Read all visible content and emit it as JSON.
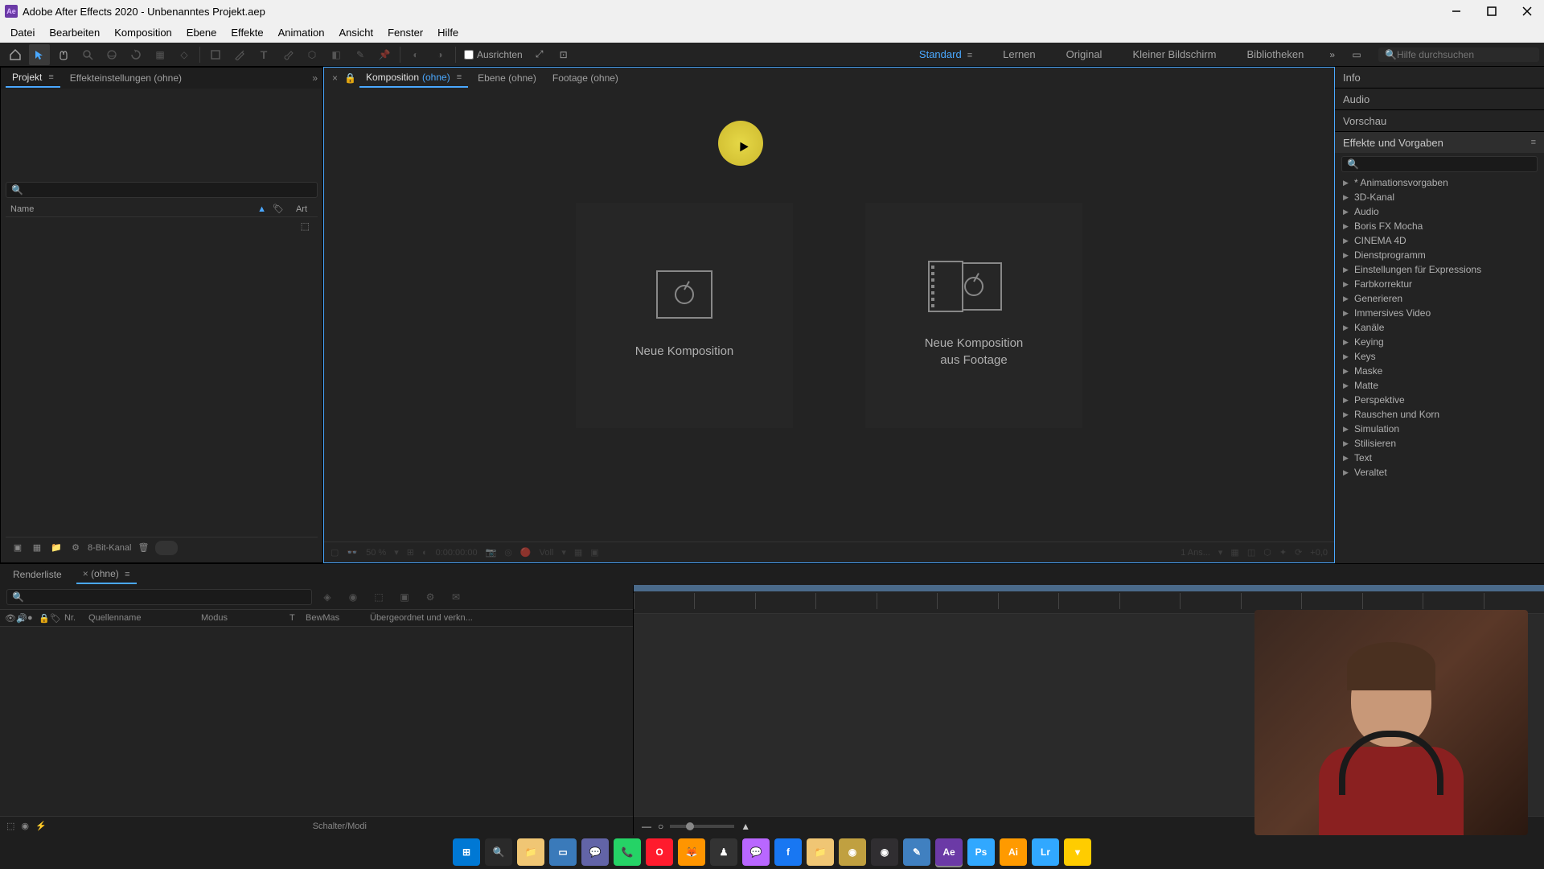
{
  "title": "Adobe After Effects 2020 - Unbenanntes Projekt.aep",
  "logo": "Ae",
  "menu": [
    "Datei",
    "Bearbeiten",
    "Komposition",
    "Ebene",
    "Effekte",
    "Animation",
    "Ansicht",
    "Fenster",
    "Hilfe"
  ],
  "toolbar": {
    "snapping": "Ausrichten",
    "workspaces": [
      "Standard",
      "Lernen",
      "Original",
      "Kleiner Bildschirm",
      "Bibliotheken"
    ],
    "active_workspace": "Standard",
    "search_placeholder": "Hilfe durchsuchen"
  },
  "left": {
    "tabs": {
      "project": "Projekt",
      "effect_controls": "Effekteinstellungen (ohne)"
    },
    "columns": {
      "name": "Name",
      "type": "Art"
    },
    "footer": {
      "depth": "8-Bit-Kanal"
    }
  },
  "center": {
    "tabs": {
      "comp_prefix": "Komposition",
      "comp_suffix": "(ohne)",
      "layer": "Ebene (ohne)",
      "footage": "Footage (ohne)"
    },
    "new_comp": "Neue Komposition",
    "new_from_footage_l1": "Neue Komposition",
    "new_from_footage_l2": "aus Footage",
    "footer": {
      "zoom": "50 %",
      "time": "0:00:00:00",
      "res": "Voll",
      "cam": "1 Ans...",
      "exp": "+0,0"
    }
  },
  "right": {
    "info": "Info",
    "audio": "Audio",
    "preview": "Vorschau",
    "effects_presets": "Effekte und Vorgaben",
    "effects": [
      "* Animationsvorgaben",
      "3D-Kanal",
      "Audio",
      "Boris FX Mocha",
      "CINEMA 4D",
      "Dienstprogramm",
      "Einstellungen für Expressions",
      "Farbkorrektur",
      "Generieren",
      "Immersives Video",
      "Kanäle",
      "Keying",
      "Keys",
      "Maske",
      "Matte",
      "Perspektive",
      "Rauschen und Korn",
      "Simulation",
      "Stilisieren",
      "Text",
      "Veraltet"
    ]
  },
  "timeline": {
    "tabs": {
      "render": "Renderliste",
      "comp": "(ohne)"
    },
    "columns": {
      "nr": "Nr.",
      "source": "Quellenname",
      "mode": "Modus",
      "trk": "T",
      "bew": "BewMas",
      "parent": "Übergeordnet und verkn..."
    },
    "footer": "Schalter/Modi"
  },
  "taskbar": [
    {
      "name": "windows-start",
      "bg": "#0078d4",
      "txt": "⊞"
    },
    {
      "name": "search",
      "bg": "#2a2a2a",
      "txt": "🔍"
    },
    {
      "name": "explorer",
      "bg": "#f0c674",
      "txt": "📁"
    },
    {
      "name": "task-view",
      "bg": "#3a7aba",
      "txt": "▭"
    },
    {
      "name": "teams",
      "bg": "#6264a7",
      "txt": "💬"
    },
    {
      "name": "whatsapp",
      "bg": "#25d366",
      "txt": "📞"
    },
    {
      "name": "opera",
      "bg": "#ff1b2d",
      "txt": "O"
    },
    {
      "name": "firefox",
      "bg": "#ff9500",
      "txt": "🦊"
    },
    {
      "name": "app1",
      "bg": "#333",
      "txt": "♟"
    },
    {
      "name": "messenger",
      "bg": "#b967ff",
      "txt": "💬"
    },
    {
      "name": "facebook",
      "bg": "#1877f2",
      "txt": "f"
    },
    {
      "name": "folder2",
      "bg": "#f0c674",
      "txt": "📁"
    },
    {
      "name": "app2",
      "bg": "#c0a040",
      "txt": "◉"
    },
    {
      "name": "obs",
      "bg": "#302e31",
      "txt": "◉"
    },
    {
      "name": "app3",
      "bg": "#4080c0",
      "txt": "✎"
    },
    {
      "name": "after-effects",
      "bg": "#6b3aa6",
      "txt": "Ae"
    },
    {
      "name": "photoshop",
      "bg": "#31a8ff",
      "txt": "Ps"
    },
    {
      "name": "illustrator",
      "bg": "#ff9a00",
      "txt": "Ai"
    },
    {
      "name": "lightroom",
      "bg": "#31a8ff",
      "txt": "Lr"
    },
    {
      "name": "app4",
      "bg": "#ffcc00",
      "txt": "▾"
    }
  ]
}
